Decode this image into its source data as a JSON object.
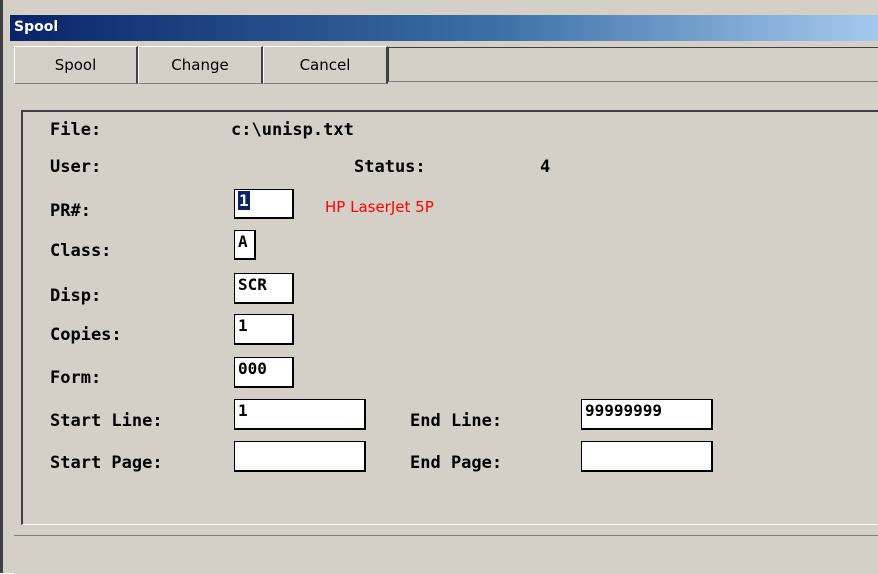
{
  "window": {
    "title": "Spool"
  },
  "tabs": [
    "Spool",
    "Change",
    "Cancel"
  ],
  "form": {
    "file_label": "File:",
    "file_value": "c:\\unisp.txt",
    "user_label": "User:",
    "status_label": "Status:",
    "status_value": "4",
    "pr_label": "PR#:",
    "pr_value": "1",
    "printer_name": "HP LaserJet 5P",
    "class_label": "Class:",
    "class_value": "A",
    "disp_label": "Disp:",
    "disp_value": "SCR",
    "copies_label": "Copies:",
    "copies_value": "1",
    "form_label": "Form:",
    "form_value": "000",
    "start_line_label": "Start Line:",
    "start_line_value": "1",
    "end_line_label": "End Line:",
    "end_line_value": "99999999",
    "start_page_label": "Start Page:",
    "start_page_value": "",
    "end_page_label": "End Page:",
    "end_page_value": ""
  },
  "colors": {
    "title_start": "#0a246a",
    "printer_text": "#ff0000",
    "face": "#d4d0c8"
  }
}
